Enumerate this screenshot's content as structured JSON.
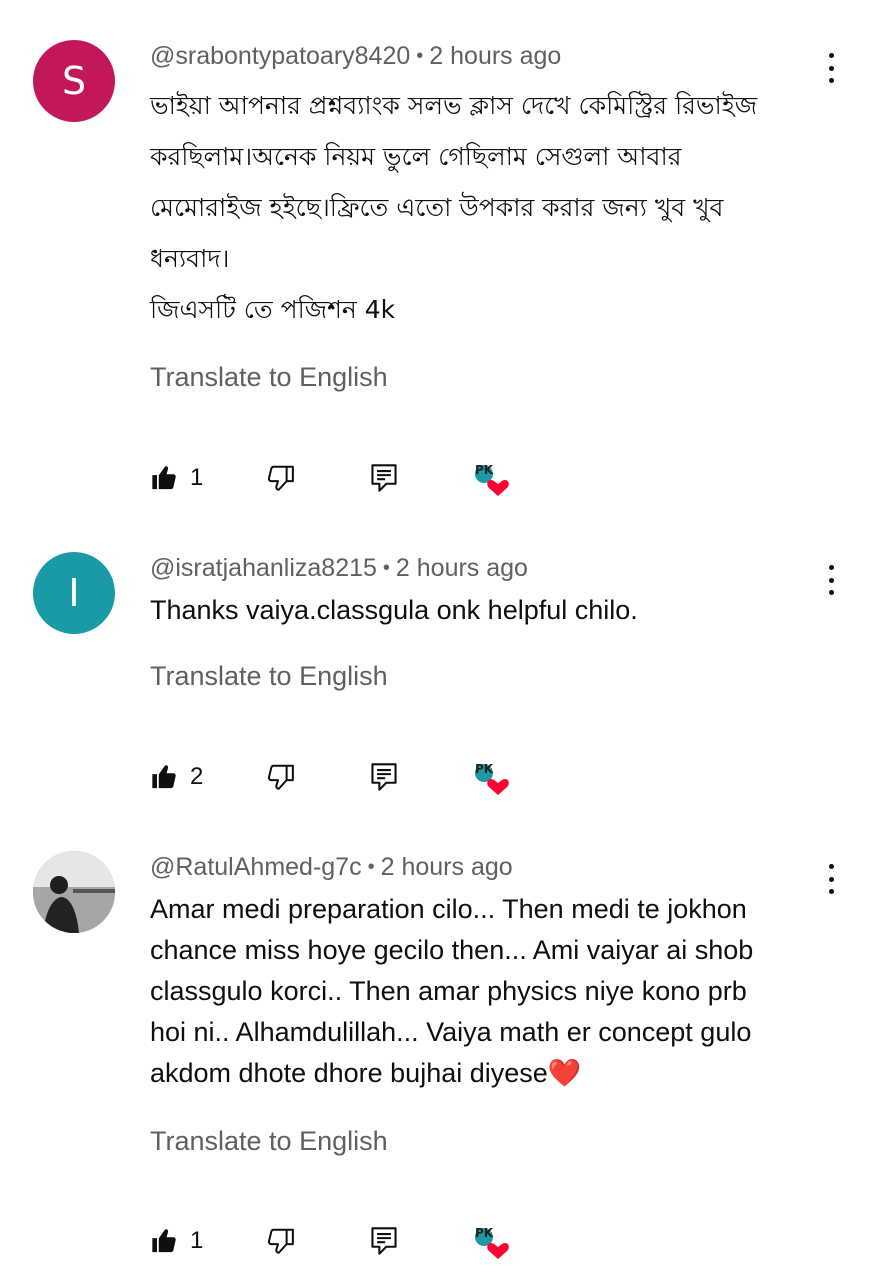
{
  "comments": [
    {
      "avatar_letter": "S",
      "avatar_color": "#c2185b",
      "author": "@srabontypatoary8420",
      "time": "2 hours ago",
      "text": "ভাইয়া আপনার প্রশ্নব্যাংক সলভ ক্লাস দেখে কেমিস্ট্রির রিভাইজ\nকরছিলাম।অনেক নিয়ম ভুলে গেছিলাম সেগুলা আবার\nমেমোরাইজ হইছে।ফ্রিতে এতো উপকার করার জন্য খুব খুব\nধন্যবাদ।\nজিএসটি তে পজিশন  4k",
      "translate": "Translate to English",
      "likes": "1"
    },
    {
      "avatar_letter": "I",
      "avatar_color": "#1a9aa6",
      "author": "@isratjahanliza8215",
      "time": "2 hours ago",
      "text": "Thanks vaiya.classgula onk helpful chilo.",
      "translate": "Translate to English",
      "likes": "2"
    },
    {
      "avatar_letter": "",
      "avatar_color": "#8a8a8a",
      "author": "@RatulAhmed-g7c",
      "time": "2 hours ago",
      "text": "Amar medi preparation cilo... Then medi te jokhon\nchance miss hoye gecilo then... Ami vaiyar ai shob\nclassgulo korci.. Then amar  physics niye kono prb\nhoi ni.. Alhamdulillah... Vaiya math er concept gulo\nakdom dhote dhore bujhai diyese❤️",
      "translate": "Translate to English",
      "likes": "1"
    }
  ],
  "icons": {
    "like": "thumbs-up-icon",
    "dislike": "thumbs-down-icon",
    "reply": "reply-icon",
    "creator_heart": "creator-heart-icon",
    "menu": "more-vert-icon"
  },
  "colors": {
    "meta": "#606060",
    "heart": "#ff0033"
  }
}
